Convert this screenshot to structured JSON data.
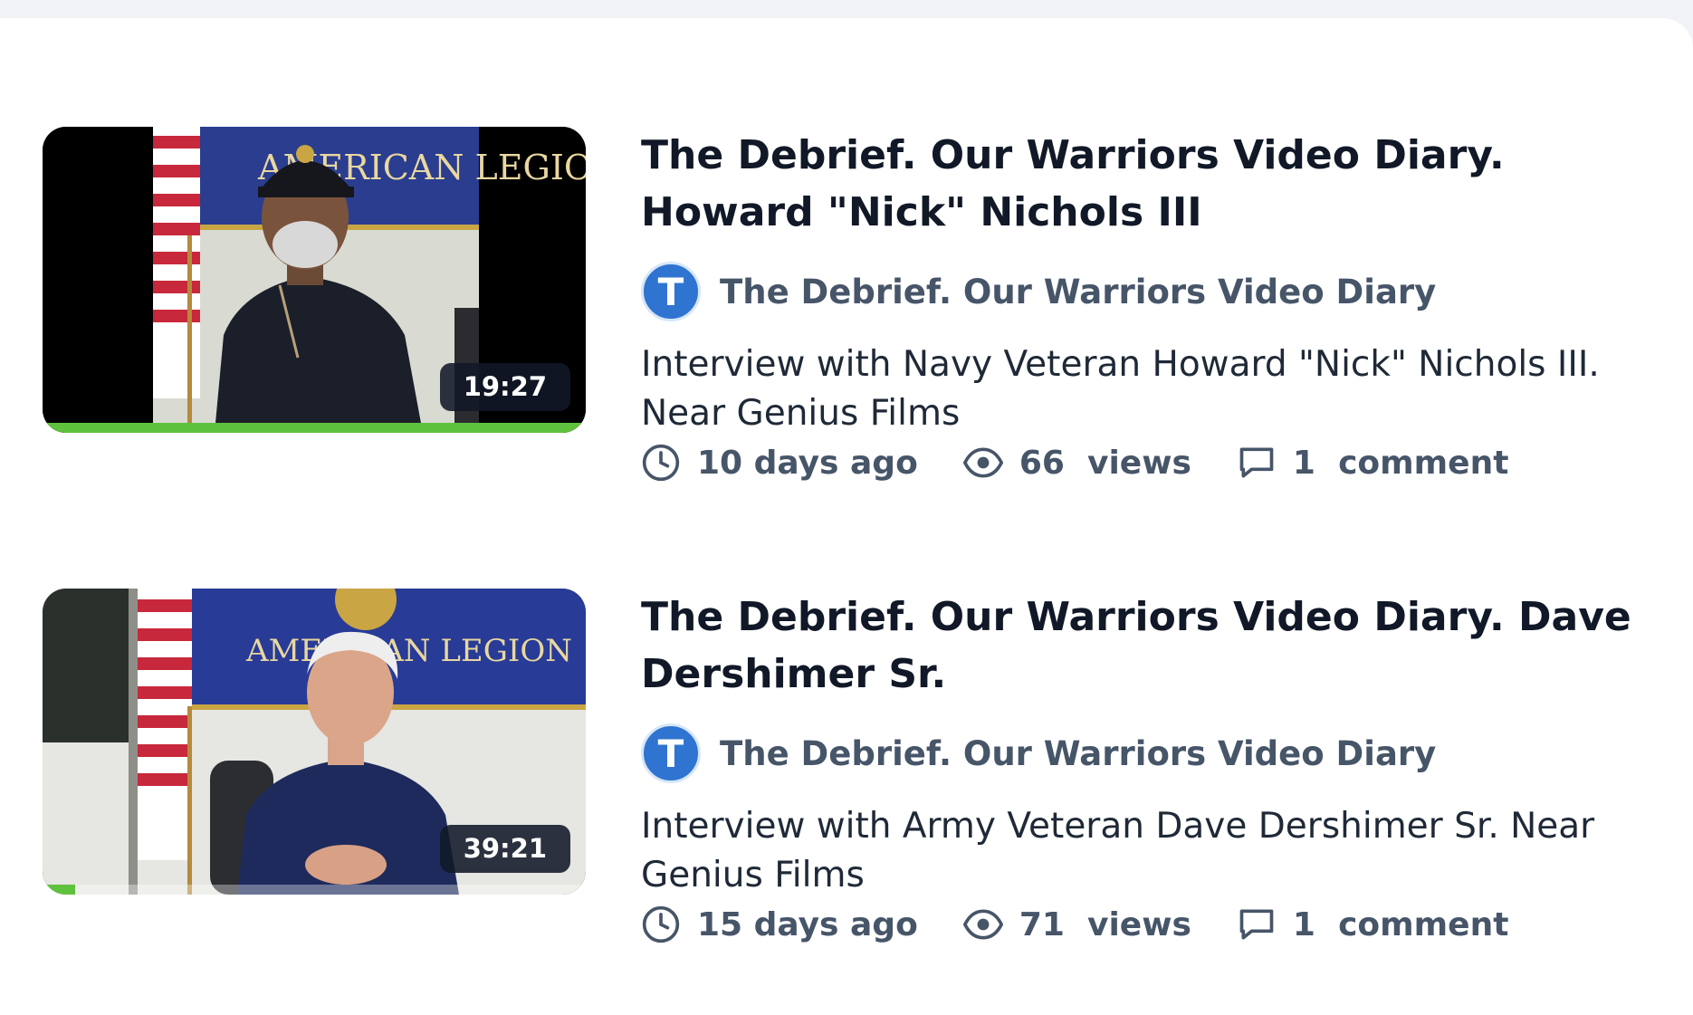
{
  "videos": [
    {
      "duration": "19:27",
      "progress": 1.0,
      "title": "The Debrief. Our Warriors Video Diary. Howard \"Nick\" Nichols III",
      "channel_initial": "T",
      "channel_name": "The Debrief. Our Warriors Video Diary",
      "description": "Interview with Navy Veteran Howard \"Nick\" Nichols III. Near Genius Films",
      "time_ago": "10 days ago",
      "views_count": "66",
      "views_label": "views",
      "comments_count": "1",
      "comments_label": "comment",
      "banner_text": "AMERICAN LEGION"
    },
    {
      "duration": "39:21",
      "progress": 0.06,
      "title": "The Debrief. Our Warriors Video Diary. Dave Dershimer Sr.",
      "channel_initial": "T",
      "channel_name": "The Debrief. Our Warriors Video Diary",
      "description": "Interview with Army Veteran Dave Dershimer Sr. Near Genius Films",
      "time_ago": "15 days ago",
      "views_count": "71",
      "views_label": "views",
      "comments_count": "1",
      "comments_label": "comment",
      "banner_text": "AMERICAN LEGION"
    }
  ],
  "icons": {
    "time": "clock-icon",
    "views": "eye-icon",
    "comments": "comment-icon"
  },
  "colors": {
    "title": "#111827",
    "meta": "#475569",
    "avatar": "#2f74d0",
    "progress": "#5fc13d",
    "duration_badge": "#111827"
  }
}
